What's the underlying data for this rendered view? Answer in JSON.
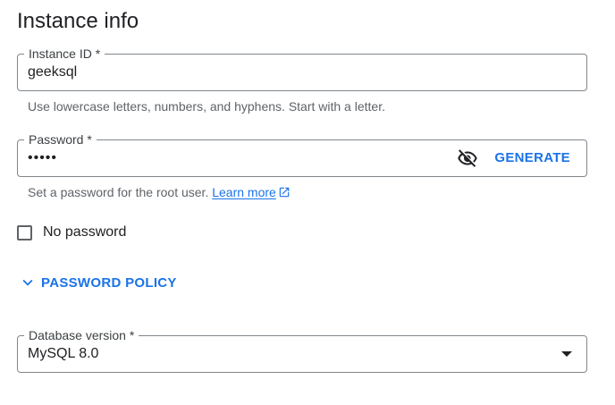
{
  "section": {
    "title": "Instance info"
  },
  "instance_id": {
    "label": "Instance ID *",
    "value": "geeksql",
    "helper": "Use lowercase letters, numbers, and hyphens. Start with a letter."
  },
  "password": {
    "label": "Password *",
    "value_masked": "•••••",
    "visibility_icon": "eye-off-icon",
    "generate_label": "GENERATE",
    "helper_text": "Set a password for the root user. ",
    "learn_more_label": "Learn more",
    "learn_more_icon": "external-link-icon"
  },
  "no_password": {
    "label": "No password",
    "checked": false
  },
  "password_policy": {
    "label": "PASSWORD POLICY",
    "icon": "chevron-down-icon"
  },
  "database_version": {
    "label": "Database version *",
    "value": "MySQL 8.0",
    "icon": "dropdown-arrow-icon"
  },
  "colors": {
    "accent": "#1a73e8",
    "text": "#202124",
    "helper": "#5f6368",
    "border": "#80868b"
  }
}
